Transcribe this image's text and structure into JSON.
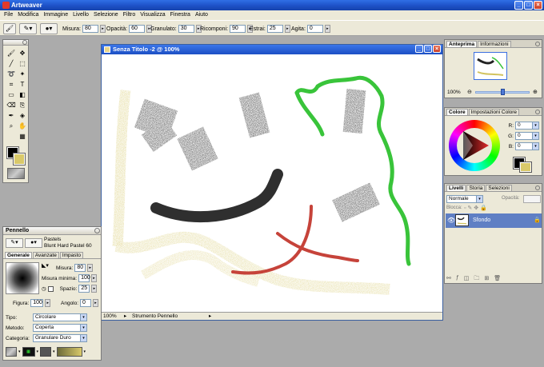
{
  "app": {
    "title": "Artweaver"
  },
  "menu": [
    "File",
    "Modifica",
    "Immagine",
    "Livello",
    "Selezione",
    "Filtro",
    "Visualizza",
    "Finestra",
    "Aiuto"
  ],
  "options": {
    "misura_label": "Misura:",
    "misura": "80",
    "opacita_label": "Opacità:",
    "opacita": "60",
    "granulato_label": "Granulato:",
    "granulato": "30",
    "ricomponi_label": "Ricomponi:",
    "ricomponi": "90",
    "estrai_label": "Estrai:",
    "estrai": "25",
    "agita_label": "Agita:",
    "agita": "0"
  },
  "document": {
    "title": "Senza Titolo -2 @ 100%",
    "zoom": "100%",
    "tool_status": "Strumento Pennello"
  },
  "navigator": {
    "tabs": [
      "Anteprima",
      "Informazioni"
    ],
    "zoom": "100%"
  },
  "colors": {
    "tabs": [
      "Colore",
      "Impostazioni Colore"
    ],
    "r_label": "R:",
    "r": "0",
    "g_label": "G:",
    "g": "0",
    "b_label": "B:",
    "b": "0",
    "foreground": "#000000",
    "background": "#d9c96a"
  },
  "layers": {
    "tabs": [
      "Livelli",
      "Storia",
      "Selezioni"
    ],
    "blend_mode": "Normale",
    "opacity_label": "Opacità:",
    "lock_label": "Blocca:",
    "items": [
      {
        "name": "Sfondo"
      }
    ]
  },
  "brush": {
    "panel_title": "Pennello",
    "category_name": "Pastels",
    "variant_name": "Blunt Hard Pastel 60",
    "tabs": [
      "Generale",
      "Avanzate",
      "Impasto"
    ],
    "misura_label": "Misura:",
    "misura": "80",
    "misura_minima_label": "Misura minima:",
    "misura_minima": "100",
    "spazio_label": "Spazio:",
    "spazio": "25",
    "figura_label": "Figura:",
    "figura": "100",
    "angolo_label": "Angolo:",
    "angolo": "0",
    "tipo_label": "Tipo:",
    "tipo": "Circolare",
    "metodo_label": "Metodo:",
    "metodo": "Coperta",
    "categoria_label": "Categoria:",
    "categoria": "Granulare Duro"
  }
}
